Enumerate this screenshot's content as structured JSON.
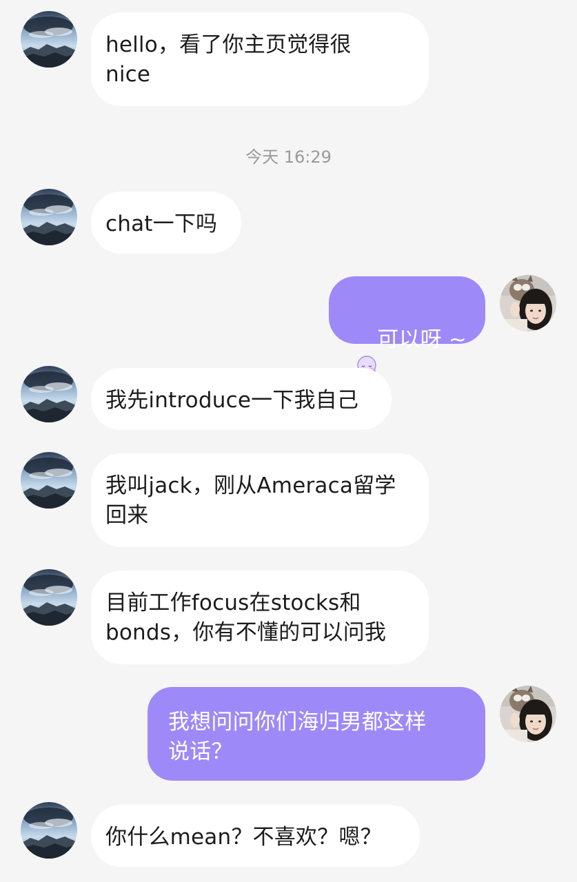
{
  "timestamp": "今天 16:29",
  "messages": [
    {
      "text": "hello，看了你主页觉得很\nnice"
    },
    {
      "text": "chat一下吗"
    },
    {
      "text": "可以呀 ~",
      "emoji": "octopus-emoji"
    },
    {
      "text": "我先introduce一下我自己"
    },
    {
      "text": "我叫jack，刚从Ameraca留学\n回来"
    },
    {
      "text": "目前工作focus在stocks和\nbonds，你有不懂的可以问我"
    },
    {
      "text": "我想问问你们海归男都这样\n说话？"
    },
    {
      "text": "你什么mean？不喜欢？嗯？"
    }
  ],
  "colors": {
    "background": "#f5f5f5",
    "incoming_bubble": "#ffffff",
    "outgoing_bubble": "#9e89f8",
    "timestamp_text": "#9a9a9a"
  },
  "icons": {
    "contact_avatar": "mountain-sky-photo-avatar",
    "self_avatar": "girl-with-cat-photo-avatar"
  }
}
